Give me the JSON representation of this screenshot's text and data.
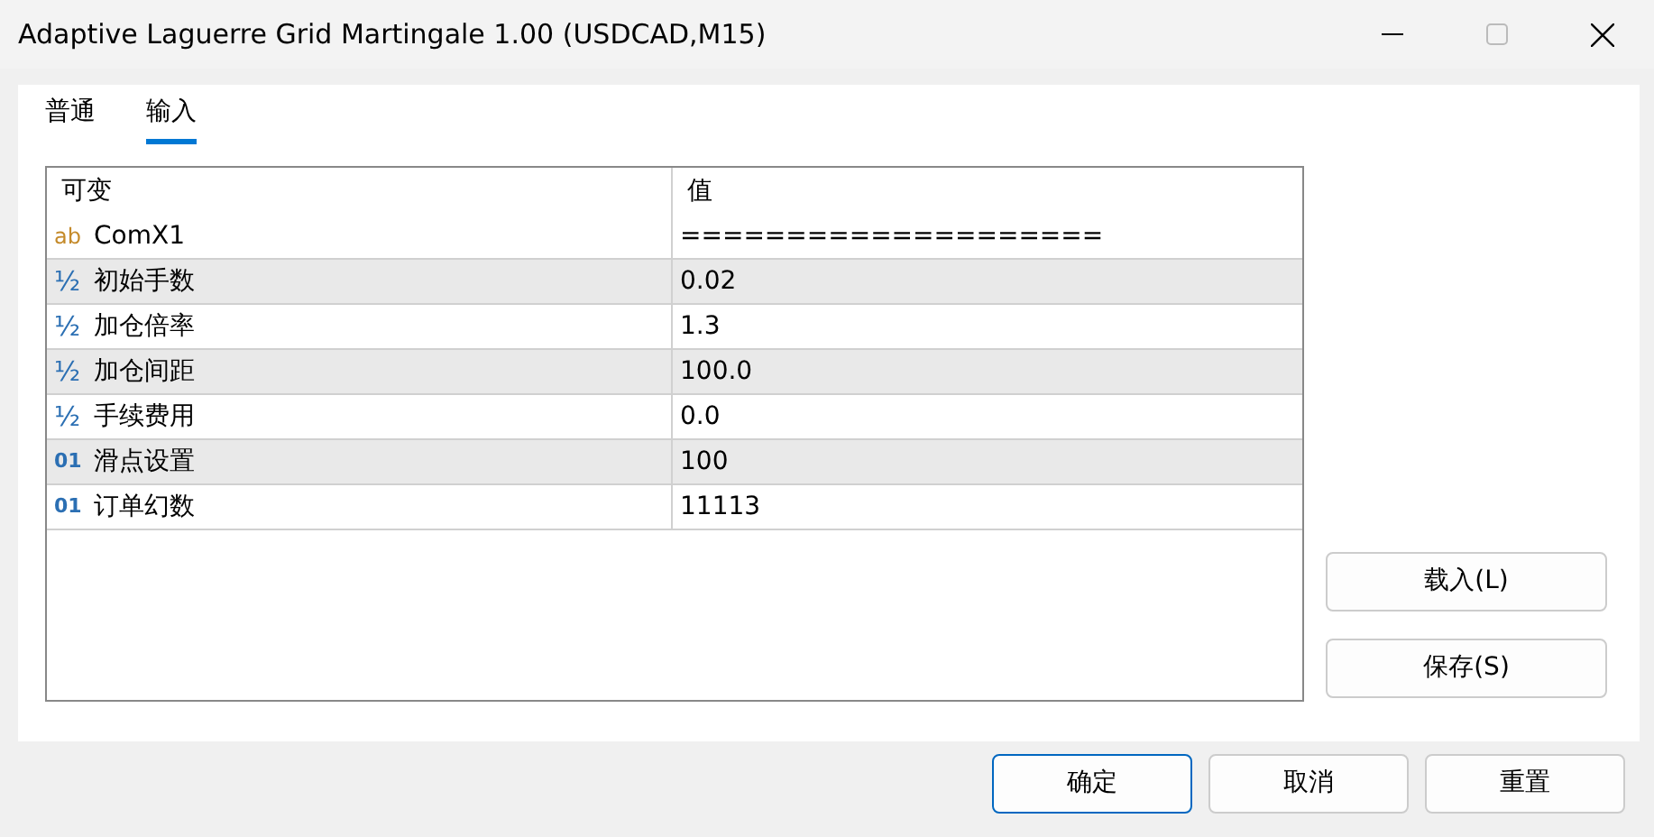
{
  "window": {
    "title": "Adaptive Laguerre Grid Martingale 1.00 (USDCAD,M15)"
  },
  "tabs": [
    {
      "label": "普通",
      "selected": false
    },
    {
      "label": "输入",
      "selected": true
    }
  ],
  "table": {
    "columns": [
      "可变",
      "值"
    ],
    "rows": [
      {
        "kind": "string",
        "icon": "ab",
        "name": "ComX1",
        "value": "===================="
      },
      {
        "kind": "double",
        "icon": "½",
        "name": "初始手数",
        "value": "0.02"
      },
      {
        "kind": "double",
        "icon": "½",
        "name": "加仓倍率",
        "value": "1.3"
      },
      {
        "kind": "double",
        "icon": "½",
        "name": "加仓间距",
        "value": "100.0"
      },
      {
        "kind": "double",
        "icon": "½",
        "name": "手续费用",
        "value": "0.0"
      },
      {
        "kind": "integer",
        "icon": "01",
        "name": "滑点设置",
        "value": "100"
      },
      {
        "kind": "integer",
        "icon": "01",
        "name": "订单幻数",
        "value": "11113"
      }
    ]
  },
  "side_buttons": [
    "载入(L)",
    "保存(S)"
  ],
  "footer_buttons": [
    {
      "label": "确定",
      "default": true
    },
    {
      "label": "取消",
      "default": false
    },
    {
      "label": "重置",
      "default": false
    }
  ]
}
